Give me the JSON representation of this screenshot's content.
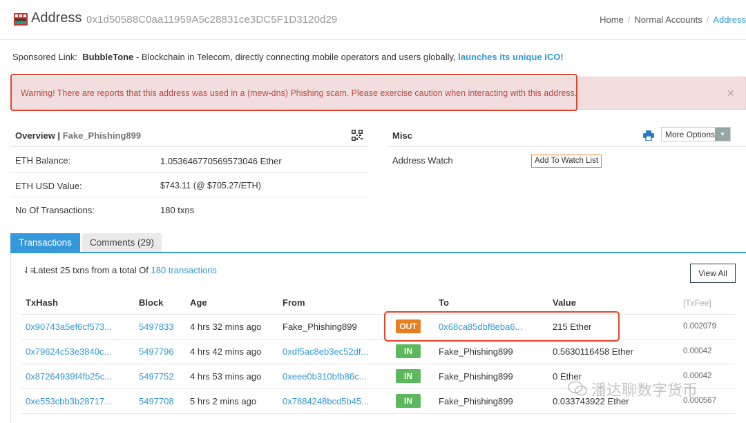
{
  "header": {
    "title": "Address",
    "address": "0x1d50588C0aa11959A5c28831ce3DC5F1D3120d29",
    "breadcrumb": [
      "Home",
      "Normal Accounts",
      "Address"
    ]
  },
  "sponsor": {
    "prefix": "Sponsored Link:",
    "brand": "BubbleTone",
    "text": " - Blockchain in Telecom, directly connecting mobile operators and users globally, ",
    "link": "launches its unique ICO!"
  },
  "alert": {
    "text": "Warning! There are reports that this address was used in a (mew-dns) Phishing scam. Please exercise caution when interacting with this address.",
    "close": "×"
  },
  "overview": {
    "title": "Overview | ",
    "tag": "Fake_Phishing899",
    "rows": [
      {
        "label": "ETH Balance:",
        "value": "1.053646770569573046 Ether"
      },
      {
        "label": "ETH USD Value:",
        "value": "$743.11 (@ $705.27/ETH)"
      },
      {
        "label": "No Of Transactions:",
        "value": "180 txns"
      }
    ]
  },
  "misc": {
    "title": "Misc",
    "more_options": "More Options",
    "watch_label": "Address Watch",
    "watch_button": "Add To Watch List"
  },
  "tabs": [
    "Transactions",
    "Comments (29)"
  ],
  "summary": {
    "text": "Latest 25 txns from a total Of ",
    "link": "180 transactions",
    "view_all": "View All"
  },
  "table": {
    "columns": [
      "TxHash",
      "Block",
      "Age",
      "From",
      "To",
      "Value",
      "[TxFee]"
    ],
    "rows": [
      {
        "hash": "0x90743a5ef6cf573...",
        "block": "5497833",
        "age": "4 hrs 32 mins ago",
        "from": "Fake_Phishing899",
        "dir": "OUT",
        "to": "0x68ca85dbf8eba6...",
        "value": "215 Ether",
        "fee": "0.002079"
      },
      {
        "hash": "0x79624c53e3840c...",
        "block": "5497796",
        "age": "4 hrs 42 mins ago",
        "from": "0xdf5ac8eb3ec52df...",
        "dir": "IN",
        "to": "Fake_Phishing899",
        "value": "0.5630116458 Ether",
        "fee": "0.00042"
      },
      {
        "hash": "0x87264939f4fb25c...",
        "block": "5497752",
        "age": "4 hrs 53 mins ago",
        "from": "0xeee0b310bfb86c...",
        "dir": "IN",
        "to": "Fake_Phishing899",
        "value": "0 Ether",
        "fee": "0.00042"
      },
      {
        "hash": "0xe553cbb3b28717...",
        "block": "5497708",
        "age": "5 hrs 2 mins ago",
        "from": "0x7884248bcd5b45...",
        "dir": "IN",
        "to": "Fake_Phishing899",
        "value": "0.033743922 Ether",
        "fee": "0.000567"
      }
    ]
  },
  "watermark": "潘达聊数字货币",
  "colors": {
    "link": "#3498db",
    "alert_bg": "#f2dede",
    "highlight": "#e2452a",
    "out": "#e67e22",
    "in": "#5cb85c"
  }
}
